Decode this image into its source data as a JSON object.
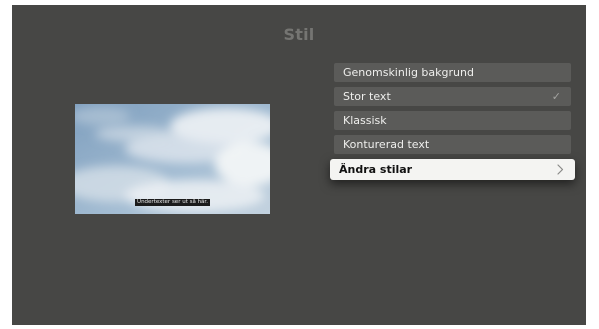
{
  "screen": {
    "title": "Stil",
    "background_color": "#474745"
  },
  "preview": {
    "caption": "Undertexter ser ut så här."
  },
  "menu": {
    "items": [
      {
        "label": "Genomskinlig bakgrund",
        "selected": false
      },
      {
        "label": "Stor text",
        "selected": true,
        "check_glyph": "✓"
      },
      {
        "label": "Klassisk",
        "selected": false
      },
      {
        "label": "Konturerad text",
        "selected": false
      }
    ],
    "action": {
      "label": "Ändra stilar",
      "focused": true,
      "icon": "chevron-right-icon"
    }
  },
  "colors": {
    "item_bg": "#5b5b59",
    "focused_bg": "#f4f4f2",
    "text": "#efefed"
  }
}
